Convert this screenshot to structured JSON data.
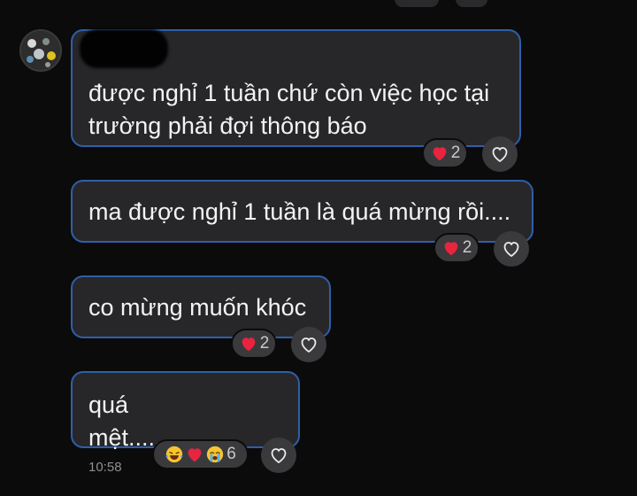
{
  "thread": {
    "messages": [
      {
        "text": "được nghỉ 1 tuần chứ còn việc học tại\ntrường phải đợi thông báo",
        "reaction_count": "2",
        "reactions": [
          "heart-icon"
        ]
      },
      {
        "text": "ma được nghỉ 1 tuần là quá mừng rồi....",
        "reaction_count": "2",
        "reactions": [
          "heart-icon"
        ]
      },
      {
        "text": "co mừng muốn khóc",
        "reaction_count": "2",
        "reactions": [
          "heart-icon"
        ]
      },
      {
        "text": "quá mệt.................",
        "time": "10:58",
        "reaction_count": "6",
        "reactions": [
          "laughing-tears-icon",
          "heart-icon",
          "crying-face-icon"
        ]
      }
    ]
  },
  "colors": {
    "background": "#0b0b0c",
    "bubble": "#27272a",
    "bubble_border": "#2f5fa8",
    "heart": "#e8243f"
  }
}
